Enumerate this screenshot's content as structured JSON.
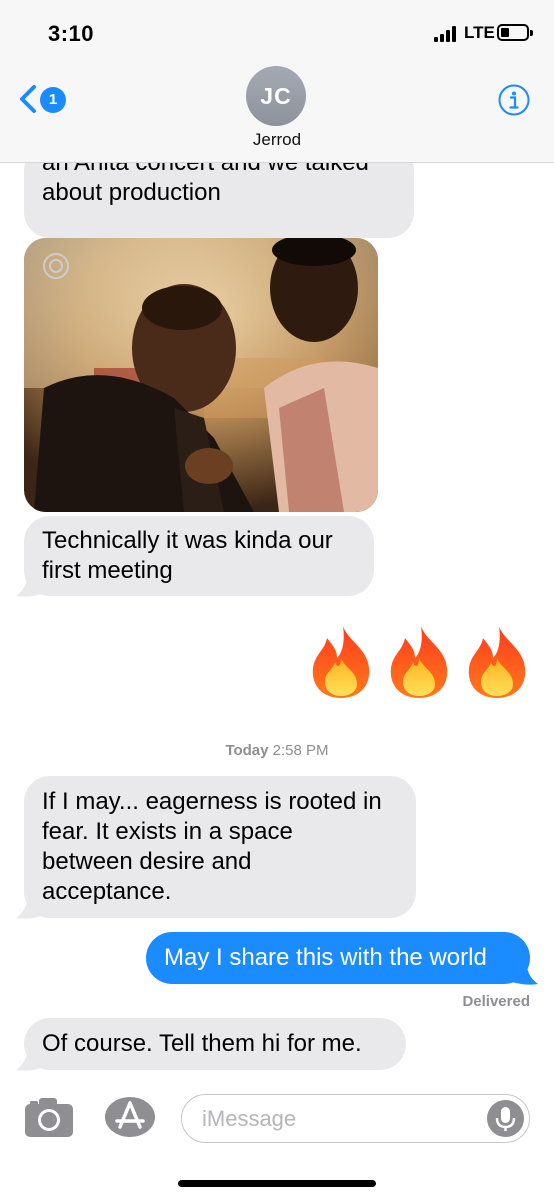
{
  "status_bar": {
    "time": "3:10",
    "network": "LTE"
  },
  "header": {
    "back_count": "1",
    "avatar_initials": "JC",
    "contact_name": "Jerrod"
  },
  "messages": [
    {
      "direction": "incoming",
      "lines": [
        "an Anita concert and we talked",
        "about production"
      ]
    },
    {
      "direction": "incoming",
      "type": "photo"
    },
    {
      "direction": "incoming",
      "lines": [
        "Technically it was kinda our",
        "first meeting"
      ]
    },
    {
      "direction": "outgoing",
      "type": "emoji",
      "text": "🔥🔥🔥"
    },
    {
      "direction": "incoming",
      "lines": [
        "If I may... eagerness is rooted in",
        "fear. It exists in a space",
        "between desire and",
        "acceptance."
      ]
    },
    {
      "direction": "outgoing",
      "text": "May I share this with the world"
    },
    {
      "direction": "incoming",
      "text": "Of course. Tell them hi for me."
    }
  ],
  "timestamp": {
    "day": "Today",
    "time": "2:58 PM"
  },
  "delivery_status": "Delivered",
  "input": {
    "placeholder": "iMessage"
  },
  "icons": {
    "back": "chevron-left-icon",
    "info": "info-icon",
    "camera": "camera-icon",
    "apps": "app-store-icon",
    "mic": "microphone-icon",
    "emoji": "fire-emoji"
  },
  "colors": {
    "accent": "#1a8cff",
    "incoming_bubble": "#e9e9eb",
    "secondary_text": "#8e8e93"
  }
}
